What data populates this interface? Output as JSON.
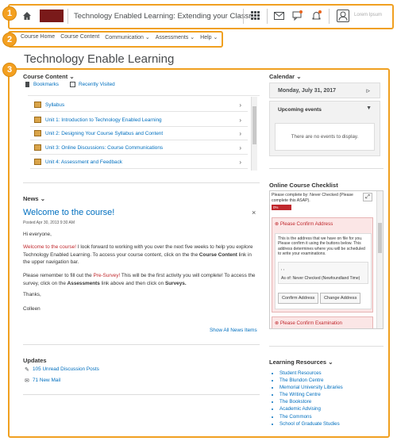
{
  "header": {
    "logo_alt": "Memorial University",
    "course_title": "Technology Enabled Learning: Extending your Classr...",
    "user_name": "Lorem Ipsum"
  },
  "nav": {
    "items": [
      "Course Home",
      "Course Content",
      "Communication",
      "Assessments",
      "Help"
    ]
  },
  "page": {
    "title": "Technology Enable Learning"
  },
  "course_content": {
    "heading": "Course Content",
    "bookmarks": "Bookmarks",
    "recent": "Recently Visited",
    "items": [
      "Syllabus",
      "Unit 1: Introduction to Technology Enabled Learning",
      "Unit 2: Designing Your Course Syllabus and Content",
      "Unit 3: Online Discussions: Course Communications",
      "Unit 4: Assessment and Feedback"
    ]
  },
  "news": {
    "heading": "News",
    "item_title": "Welcome to the course!",
    "posted": "Posted Apr 30, 2013 9:30 AM",
    "greeting": "Hi everyone,",
    "p1_red": "Welcome to the course!",
    "p1_rest": " I look forward to working with you over the next five weeks to help you explore Technology Enabled Learning. To access your course content, click on the the ",
    "p1_bold": "Course Content",
    "p1_end": " link in the upper navigation bar.",
    "p2_start": "Please remember to fill out the ",
    "p2_red": "Pre-Survey!",
    "p2_mid": " This will be the first activity you will complete! To access the survey, click on the ",
    "p2_bold1": "Assessments",
    "p2_mid2": " link above and then click on ",
    "p2_bold2": "Surveys.",
    "thanks": "Thanks,",
    "signature": "Colleen",
    "show_all": "Show All News Items"
  },
  "updates": {
    "heading": "Updates",
    "discussion": "105 Unread Discussion Posts",
    "mail": "71 New Mail"
  },
  "calendar": {
    "heading": "Calendar",
    "date": "Monday, July 31, 2017",
    "upcoming": "Upcoming events",
    "empty": "There are no events to display."
  },
  "checklist": {
    "heading": "Online Course Checklist",
    "intro": "Please complete by: Never Checked (Please complete this ASAP).",
    "progress_label": "0% Complete",
    "progress": 0,
    "item1_title": "Please Confirm Address",
    "item1_body": "This is the address that we have on file for you. Please confirm it using the buttons below. This address determines where you will be scheduled to write your examinations.",
    "item1_dots": ", ,",
    "item1_asof": "As of:  Never Checked (Newfoundland Time)",
    "confirm_btn": "Confirm Address",
    "change_btn": "Change Address",
    "item2_title": "Please Confirm Examination"
  },
  "resources": {
    "heading": "Learning Resources",
    "items": [
      "Student Resources",
      "The Blundon Centre",
      "Memorial University Libraries",
      "The Writing Centre",
      "The Bookstore",
      "Academic Advising",
      "The Commons",
      "School of Graduate Studies"
    ]
  },
  "callouts": [
    "1",
    "2",
    "3"
  ],
  "colors": {
    "accent": "#f4a020",
    "link": "#006fbf",
    "alert_red": "#c0282d"
  }
}
